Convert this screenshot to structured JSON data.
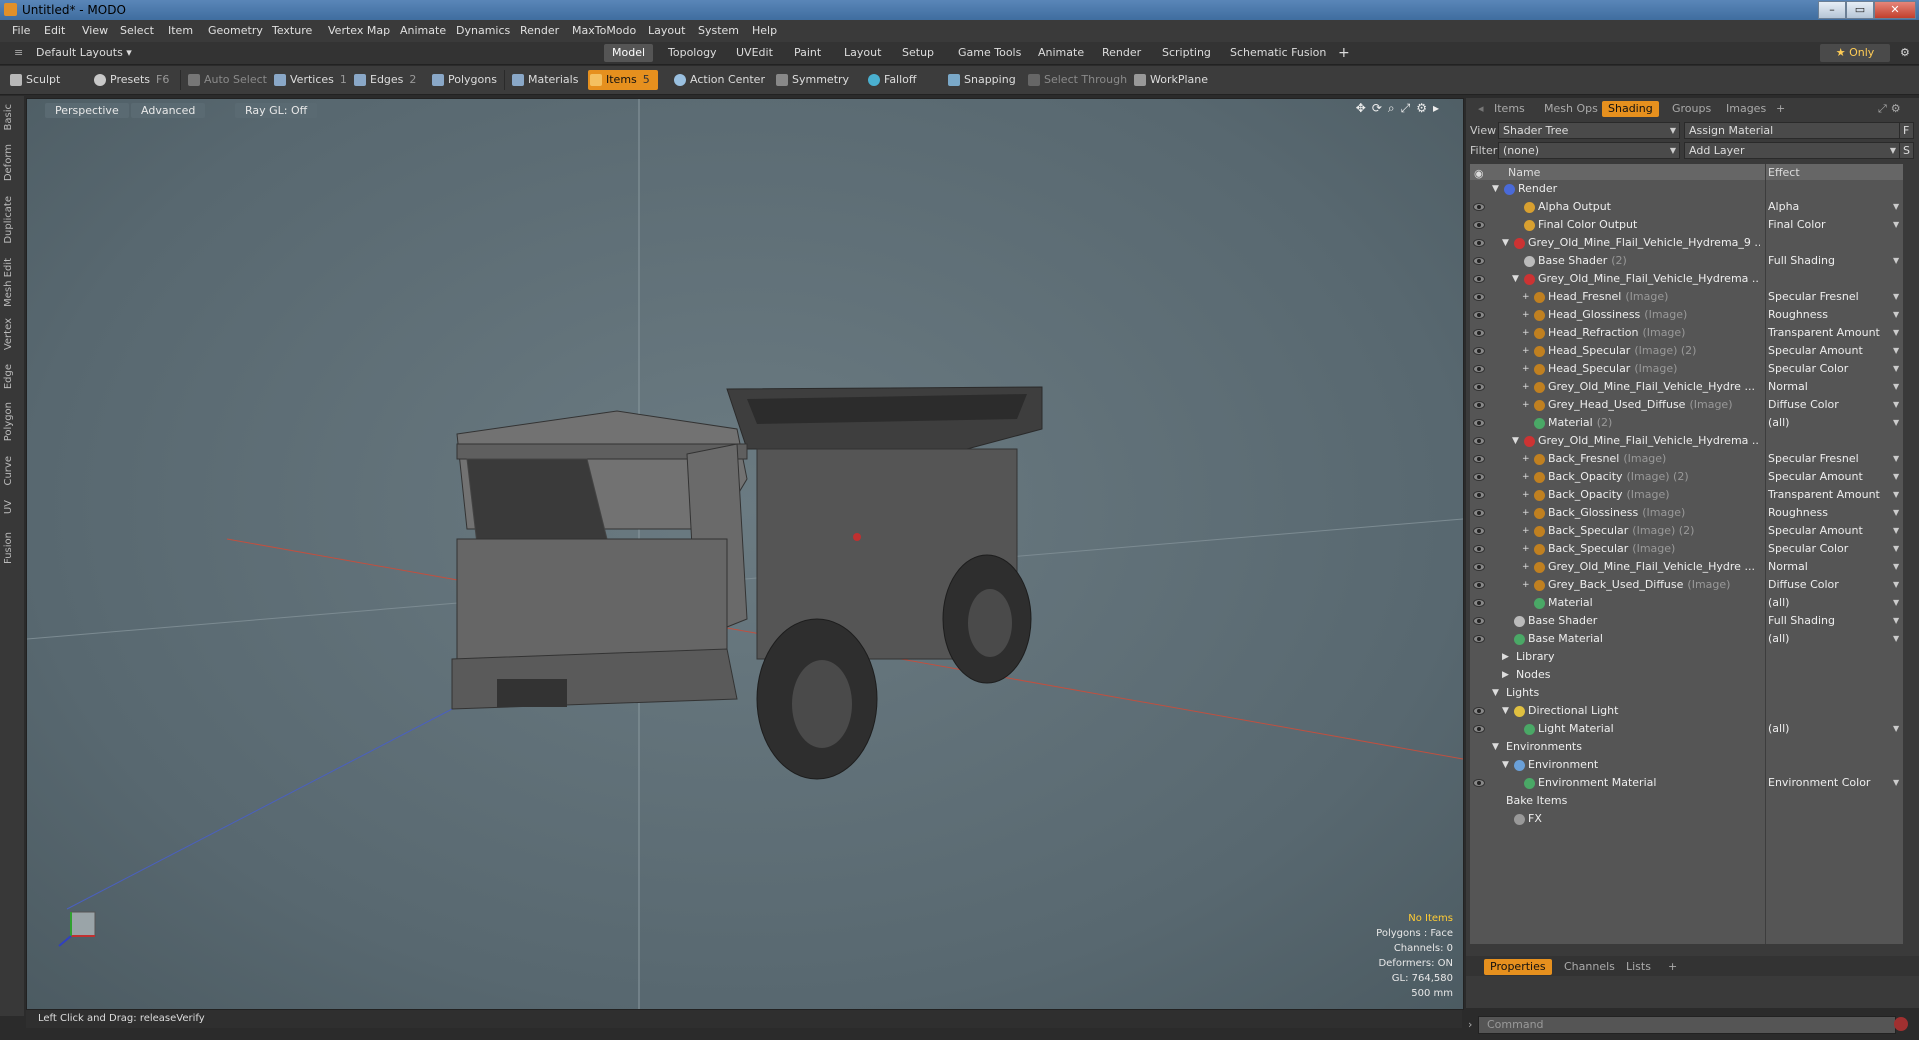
{
  "window": {
    "title": "Untitled* - MODO",
    "minimize": "–",
    "maximize": "▭",
    "close": "✕"
  },
  "menubar": [
    "File",
    "Edit",
    "View",
    "Select",
    "Item",
    "Geometry",
    "Texture",
    "Vertex Map",
    "Animate",
    "Dynamics",
    "Render",
    "MaxToModo",
    "Layout",
    "System",
    "Help"
  ],
  "layoutbar": {
    "preset": "Default Layouts ▾",
    "tabs": [
      "Model",
      "Topology",
      "UVEdit",
      "Paint",
      "Layout",
      "Setup",
      "Game Tools",
      "Animate",
      "Render",
      "Scripting",
      "Schematic Fusion"
    ],
    "active_tab": "Model",
    "add": "+",
    "only": "★ Only"
  },
  "toolbar": {
    "sculpt": "Sculpt",
    "presets": "Presets",
    "presets_key": "F6",
    "auto_select": "Auto Select",
    "vertices": "Vertices",
    "vertices_key": "1",
    "edges": "Edges",
    "edges_key": "2",
    "polygons": "Polygons",
    "materials": "Materials",
    "items": "Items",
    "items_key": "5",
    "action_center": "Action Center",
    "symmetry": "Symmetry",
    "falloff": "Falloff",
    "snapping": "Snapping",
    "select_through": "Select Through",
    "workplane": "WorkPlane"
  },
  "lefttabs": [
    "Basic",
    "Deform",
    "Duplicate",
    "Mesh Edit",
    "Vertex",
    "Edge",
    "Polygon",
    "Curve",
    "UV",
    "Fusion"
  ],
  "viewport": {
    "perspective": "Perspective",
    "advanced": "Advanced",
    "raygl": "Ray GL: Off",
    "info": {
      "no_items": "No Items",
      "polygons": "Polygons : Face",
      "channels": "Channels: 0",
      "deformers": "Deformers: ON",
      "gl": "GL: 764,580",
      "scale": "500 mm"
    }
  },
  "status": {
    "text": "Left Click and Drag:  releaseVerify"
  },
  "rightpanel": {
    "tabs": [
      "Items",
      "Mesh Ops",
      "Shading",
      "Groups",
      "Images",
      "+"
    ],
    "active_tab": "Shading",
    "view_label": "View",
    "view_value": "Shader Tree",
    "assign_material": "Assign Material",
    "filter_label": "Filter",
    "filter_value": "(none)",
    "add_layer": "Add Layer",
    "f_btn": "F",
    "s_btn": "S",
    "col_name": "Name",
    "col_effect": "Effect",
    "bottom_tabs": [
      "Properties",
      "Channels",
      "Lists",
      "+"
    ],
    "command_placeholder": "Command"
  },
  "tree": [
    {
      "name": "Render",
      "sub": "",
      "effect": "",
      "indent": 0,
      "tw": "▼",
      "eye": false,
      "node": "#4a6ad8"
    },
    {
      "name": "Alpha Output",
      "sub": "",
      "effect": "Alpha",
      "indent": 2,
      "tw": "",
      "eye": true,
      "node": "#d8a030"
    },
    {
      "name": "Final Color Output",
      "sub": "",
      "effect": "Final Color",
      "indent": 2,
      "tw": "",
      "eye": true,
      "node": "#d8a030"
    },
    {
      "name": "Grey_Old_Mine_Flail_Vehicle_Hydrema_9 ...",
      "sub": "",
      "effect": "",
      "indent": 1,
      "tw": "▼",
      "eye": true,
      "node": "#cc3333"
    },
    {
      "name": "Base Shader",
      "sub": "(2)",
      "effect": "Full Shading",
      "indent": 2,
      "tw": "",
      "eye": true,
      "node": "#bbbbbb"
    },
    {
      "name": "Grey_Old_Mine_Flail_Vehicle_Hydrema ...",
      "sub": "",
      "effect": "",
      "indent": 2,
      "tw": "▼",
      "eye": true,
      "node": "#cc3333"
    },
    {
      "name": "Head_Fresnel",
      "sub": "(Image)",
      "effect": "Specular Fresnel",
      "indent": 3,
      "tw": "+",
      "eye": true,
      "node": "#c08020"
    },
    {
      "name": "Head_Glossiness",
      "sub": "(Image)",
      "effect": "Roughness",
      "indent": 3,
      "tw": "+",
      "eye": true,
      "node": "#c08020"
    },
    {
      "name": "Head_Refraction",
      "sub": "(Image)",
      "effect": "Transparent Amount",
      "indent": 3,
      "tw": "+",
      "eye": true,
      "node": "#c08020"
    },
    {
      "name": "Head_Specular",
      "sub": "(Image) (2)",
      "effect": "Specular Amount",
      "indent": 3,
      "tw": "+",
      "eye": true,
      "node": "#c08020"
    },
    {
      "name": "Head_Specular",
      "sub": "(Image)",
      "effect": "Specular Color",
      "indent": 3,
      "tw": "+",
      "eye": true,
      "node": "#c08020"
    },
    {
      "name": "Grey_Old_Mine_Flail_Vehicle_Hydre ...",
      "sub": "",
      "effect": "Normal",
      "indent": 3,
      "tw": "+",
      "eye": true,
      "node": "#c08020"
    },
    {
      "name": "Grey_Head_Used_Diffuse",
      "sub": "(Image)",
      "effect": "Diffuse Color",
      "indent": 3,
      "tw": "+",
      "eye": true,
      "node": "#c08020"
    },
    {
      "name": "Material",
      "sub": "(2)",
      "effect": "(all)",
      "indent": 3,
      "tw": "",
      "eye": true,
      "node": "#4aa866"
    },
    {
      "name": "Grey_Old_Mine_Flail_Vehicle_Hydrema ...",
      "sub": "",
      "effect": "",
      "indent": 2,
      "tw": "▼",
      "eye": true,
      "node": "#cc3333"
    },
    {
      "name": "Back_Fresnel",
      "sub": "(Image)",
      "effect": "Specular Fresnel",
      "indent": 3,
      "tw": "+",
      "eye": true,
      "node": "#c08020"
    },
    {
      "name": "Back_Opacity",
      "sub": "(Image) (2)",
      "effect": "Specular Amount",
      "indent": 3,
      "tw": "+",
      "eye": true,
      "node": "#c08020"
    },
    {
      "name": "Back_Opacity",
      "sub": "(Image)",
      "effect": "Transparent Amount",
      "indent": 3,
      "tw": "+",
      "eye": true,
      "node": "#c08020"
    },
    {
      "name": "Back_Glossiness",
      "sub": "(Image)",
      "effect": "Roughness",
      "indent": 3,
      "tw": "+",
      "eye": true,
      "node": "#c08020"
    },
    {
      "name": "Back_Specular",
      "sub": "(Image) (2)",
      "effect": "Specular Amount",
      "indent": 3,
      "tw": "+",
      "eye": true,
      "node": "#c08020"
    },
    {
      "name": "Back_Specular",
      "sub": "(Image)",
      "effect": "Specular Color",
      "indent": 3,
      "tw": "+",
      "eye": true,
      "node": "#c08020"
    },
    {
      "name": "Grey_Old_Mine_Flail_Vehicle_Hydre ...",
      "sub": "",
      "effect": "Normal",
      "indent": 3,
      "tw": "+",
      "eye": true,
      "node": "#c08020"
    },
    {
      "name": "Grey_Back_Used_Diffuse",
      "sub": "(Image)",
      "effect": "Diffuse Color",
      "indent": 3,
      "tw": "+",
      "eye": true,
      "node": "#c08020"
    },
    {
      "name": "Material",
      "sub": "",
      "effect": "(all)",
      "indent": 3,
      "tw": "",
      "eye": true,
      "node": "#4aa866"
    },
    {
      "name": "Base Shader",
      "sub": "",
      "effect": "Full Shading",
      "indent": 1,
      "tw": "",
      "eye": true,
      "node": "#bbbbbb"
    },
    {
      "name": "Base Material",
      "sub": "",
      "effect": "(all)",
      "indent": 1,
      "tw": "",
      "eye": true,
      "node": "#4aa866"
    },
    {
      "name": "Library",
      "sub": "",
      "effect": "",
      "indent": 1,
      "tw": "▶",
      "eye": false,
      "node": ""
    },
    {
      "name": "Nodes",
      "sub": "",
      "effect": "",
      "indent": 1,
      "tw": "▶",
      "eye": false,
      "node": ""
    },
    {
      "name": "Lights",
      "sub": "",
      "effect": "",
      "indent": 0,
      "tw": "▼",
      "eye": false,
      "node": ""
    },
    {
      "name": "Directional Light",
      "sub": "",
      "effect": "",
      "indent": 1,
      "tw": "▼",
      "eye": true,
      "node": "#e0c040"
    },
    {
      "name": "Light Material",
      "sub": "",
      "effect": "(all)",
      "indent": 2,
      "tw": "",
      "eye": true,
      "node": "#4aa866"
    },
    {
      "name": "Environments",
      "sub": "",
      "effect": "",
      "indent": 0,
      "tw": "▼",
      "eye": false,
      "node": ""
    },
    {
      "name": "Environment",
      "sub": "",
      "effect": "",
      "indent": 1,
      "tw": "▼",
      "eye": false,
      "node": "#6aa0d8"
    },
    {
      "name": "Environment Material",
      "sub": "",
      "effect": "Environment Color",
      "indent": 2,
      "tw": "",
      "eye": true,
      "node": "#4aa866"
    },
    {
      "name": "Bake Items",
      "sub": "",
      "effect": "",
      "indent": 0,
      "tw": "",
      "eye": false,
      "node": ""
    },
    {
      "name": "FX",
      "sub": "",
      "effect": "",
      "indent": 1,
      "tw": "",
      "eye": false,
      "node": "#999999"
    }
  ]
}
